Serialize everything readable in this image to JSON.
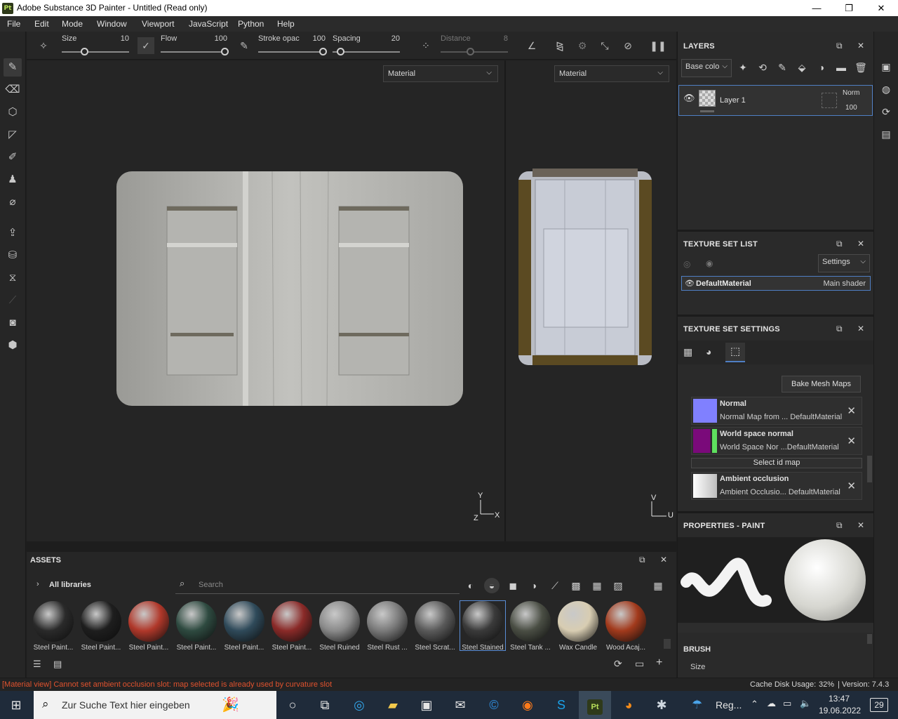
{
  "window": {
    "title": "Adobe Substance 3D Painter - Untitled (Read only)",
    "app_badge": "Pt",
    "minimize": "—",
    "maximize": "❐",
    "close": "✕"
  },
  "menu": [
    "File",
    "Edit",
    "Mode",
    "Window",
    "Viewport",
    "JavaScript",
    "Python",
    "Help"
  ],
  "toolbar": {
    "size_label": "Size",
    "size_value": "10",
    "flow_label": "Flow",
    "flow_value": "100",
    "stroke_label": "Stroke opac",
    "stroke_value": "100",
    "spacing_label": "Spacing",
    "spacing_value": "20",
    "distance_label": "Distance",
    "distance_value": "8"
  },
  "viewport": {
    "left_mode": "Material",
    "right_mode": "Material",
    "axis_y": "Y",
    "axis_x": "X",
    "axis_z": "Z",
    "uv_v": "V",
    "uv_u": "U"
  },
  "layers": {
    "title": "LAYERS",
    "channel": "Base colo",
    "layer_name": "Layer 1",
    "blend": "Norm",
    "opacity": "100"
  },
  "texture_set_list": {
    "title": "TEXTURE SET LIST",
    "settings": "Settings",
    "material": "DefaultMaterial",
    "shader": "Main shader"
  },
  "texture_set_settings": {
    "title": "TEXTURE SET SETTINGS",
    "bake_button": "Bake Mesh Maps",
    "maps": [
      {
        "name": "Normal",
        "detail": "Normal Map from ... DefaultMaterial",
        "color": "#8080ff"
      },
      {
        "name": "World space normal",
        "detail": "World Space Nor ...DefaultMaterial",
        "color": "#7a0a7a"
      },
      {
        "name": "Ambient occlusion",
        "detail": "Ambient Occlusio... DefaultMaterial",
        "color": "#e8e8e8"
      }
    ],
    "select_id": "Select id map"
  },
  "properties": {
    "title": "PROPERTIES - PAINT",
    "brush_label": "BRUSH",
    "size_label": "Size"
  },
  "assets": {
    "title": "ASSETS",
    "libraries": "All libraries",
    "search_placeholder": "Search",
    "items": [
      {
        "label": "Steel Paint...",
        "color": "#2a2a2a"
      },
      {
        "label": "Steel Paint...",
        "color": "#1e1e1e"
      },
      {
        "label": "Steel Paint...",
        "color": "#b0382a"
      },
      {
        "label": "Steel Paint...",
        "color": "#2e4a40"
      },
      {
        "label": "Steel Paint...",
        "color": "#2f4a5a"
      },
      {
        "label": "Steel Paint...",
        "color": "#8a2a28"
      },
      {
        "label": "Steel Ruined",
        "color": "#8a8a8a"
      },
      {
        "label": "Steel Rust ...",
        "color": "#7a7a7a"
      },
      {
        "label": "Steel Scrat...",
        "color": "#5a5a5a"
      },
      {
        "label": "Steel Stained",
        "color": "#3a3a3a"
      },
      {
        "label": "Steel Tank ...",
        "color": "#4a4e44"
      },
      {
        "label": "Wax Candle",
        "color": "#d8cdb2"
      },
      {
        "label": "Wood Acaj...",
        "color": "#a23a1c"
      }
    ]
  },
  "status": {
    "message": "[Material view] Cannot set ambient occlusion slot: map selected is already used by curvature slot",
    "cache": "Cache Disk Usage:",
    "cache_value": "32%",
    "version": "| Version: 7.4.3"
  },
  "taskbar": {
    "search_placeholder": "Zur Suche Text hier eingeben",
    "weather": "Reg...",
    "time": "13:47",
    "date": "19.06.2022",
    "notifications": "29"
  }
}
